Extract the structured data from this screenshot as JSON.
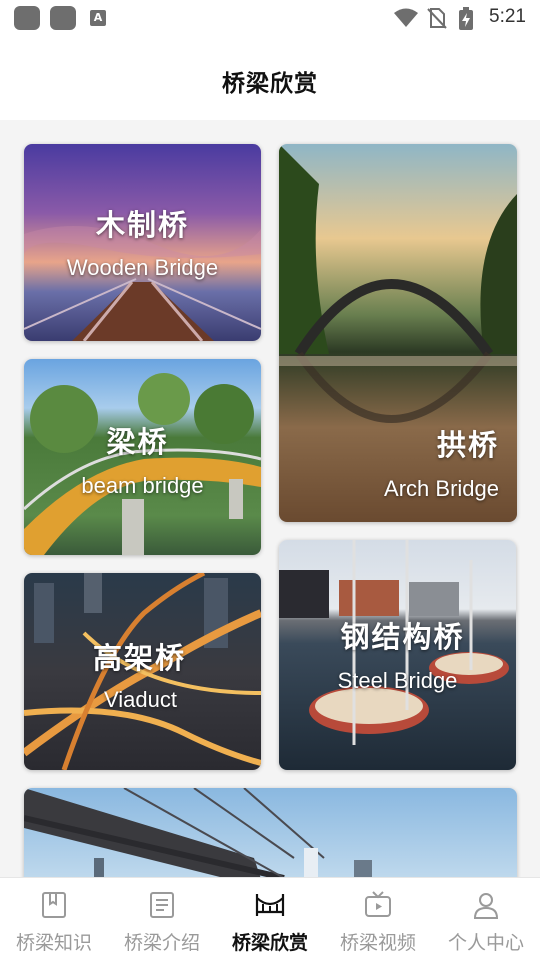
{
  "status_bar": {
    "time": "5:21",
    "left_icons": [
      "app-icon",
      "app-icon",
      "text-a-icon"
    ],
    "right_icons": [
      "wifi-icon",
      "no-sim-icon",
      "battery-charging-icon"
    ]
  },
  "header": {
    "title": "桥梁欣赏"
  },
  "cards": [
    {
      "id": "wooden",
      "zh": "木制桥",
      "en": "Wooden Bridge"
    },
    {
      "id": "arch",
      "zh": "拱桥",
      "en": "Arch Bridge"
    },
    {
      "id": "beam",
      "zh": "梁桥",
      "en": "beam bridge"
    },
    {
      "id": "steel",
      "zh": "钢结构桥",
      "en": "Steel Bridge"
    },
    {
      "id": "viaduct",
      "zh": "高架桥",
      "en": "Viaduct"
    },
    {
      "id": "suspension"
    }
  ],
  "tabs": [
    {
      "label": "桥梁知识",
      "icon": "book-icon",
      "active": false
    },
    {
      "label": "桥梁介绍",
      "icon": "document-icon",
      "active": false
    },
    {
      "label": "桥梁欣赏",
      "icon": "bridge-icon",
      "active": true
    },
    {
      "label": "桥梁视频",
      "icon": "tv-icon",
      "active": false
    },
    {
      "label": "个人中心",
      "icon": "person-icon",
      "active": false
    }
  ],
  "colors": {
    "active_tab": "#111111",
    "inactive_tab": "#9a9a9a",
    "background": "#f4f4f4"
  }
}
